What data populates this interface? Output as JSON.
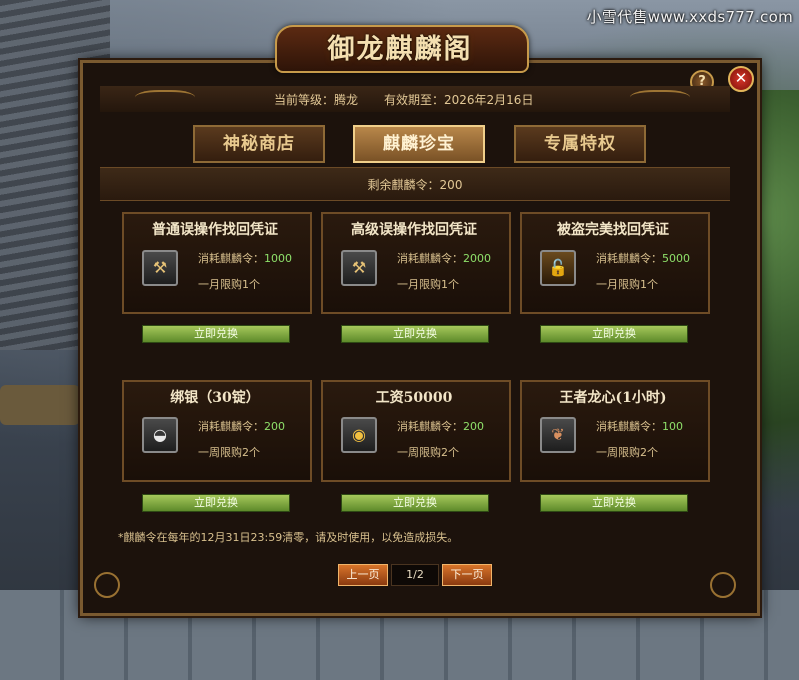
{
  "watermark": "小雪代售www.xxds777.com",
  "window": {
    "title": "御龙麒麟阁",
    "help_label": "?",
    "close_label": "✕",
    "status": {
      "level": "当前等级：腾龙",
      "expiry": "有效期至：2026年2月16日"
    },
    "tabs": [
      {
        "label": "神秘商店",
        "active": false
      },
      {
        "label": "麒麟珍宝",
        "active": true
      },
      {
        "label": "专属特权",
        "active": false
      }
    ],
    "remaining": "剩余麒麟令：200"
  },
  "cost_label": "消耗麒麟令：",
  "redeem_label": "立即兑换",
  "items": [
    {
      "title": "普通误操作找回凭证",
      "icon": "wrench-icon",
      "cost": "1000",
      "limit": "一月限购1个"
    },
    {
      "title": "高级误操作找回凭证",
      "icon": "wrench-icon",
      "cost": "2000",
      "limit": "一月限购1个"
    },
    {
      "title": "被盗完美找回凭证",
      "icon": "unlock-icon",
      "cost": "5000",
      "limit": "一月限购1个"
    },
    {
      "title": "绑银（30锭）",
      "icon": "silver-ingot-icon",
      "cost": "200",
      "limit": "一周限购2个"
    },
    {
      "title": "工资50000",
      "icon": "gold-pile-icon",
      "cost": "200",
      "limit": "一周限购2个"
    },
    {
      "title": "王者龙心(1小时)",
      "icon": "dragon-heart-icon",
      "cost": "100",
      "limit": "一周限购2个"
    }
  ],
  "note": "*麒麟令在每年的12月31日23:59清零，请及时使用，以免造成损失。",
  "pager": {
    "prev": "上一页",
    "page": "1/2",
    "next": "下一页"
  }
}
